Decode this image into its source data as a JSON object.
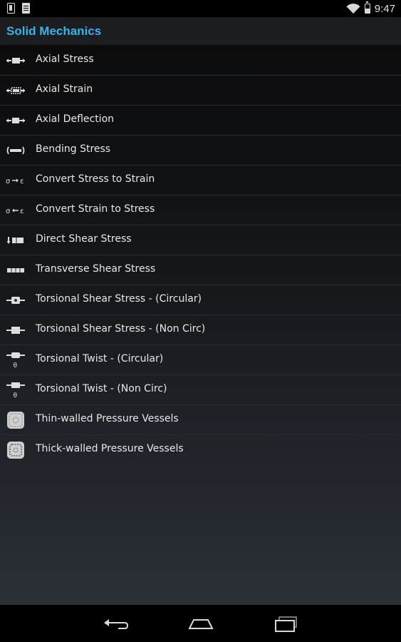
{
  "status_bar": {
    "time": "9:47",
    "icons": [
      "notification-icon",
      "sd-card-icon",
      "wifi-icon",
      "battery-icon"
    ]
  },
  "action_bar": {
    "title": "Solid Mechanics"
  },
  "list": {
    "items": [
      {
        "label": "Axial Stress",
        "icon": "axial-stress-icon"
      },
      {
        "label": "Axial Strain",
        "icon": "axial-strain-icon"
      },
      {
        "label": "Axial Deflection",
        "icon": "axial-deflection-icon"
      },
      {
        "label": "Bending Stress",
        "icon": "bending-stress-icon"
      },
      {
        "label": "Convert Stress to Strain",
        "icon": "sigma-to-epsilon-icon"
      },
      {
        "label": "Convert Strain to Stress",
        "icon": "sigma-from-epsilon-icon"
      },
      {
        "label": "Direct Shear Stress",
        "icon": "direct-shear-icon"
      },
      {
        "label": "Transverse Shear Stress",
        "icon": "transverse-shear-icon"
      },
      {
        "label": "Torsional Shear Stress - (Circular)",
        "icon": "torsion-circular-icon"
      },
      {
        "label": "Torsional Shear Stress - (Non Circ)",
        "icon": "torsion-noncirc-icon"
      },
      {
        "label": "Torsional Twist - (Circular)",
        "icon": "twist-circular-icon"
      },
      {
        "label": "Torsional Twist - (Non Circ)",
        "icon": "twist-noncirc-icon"
      },
      {
        "label": "Thin-walled Pressure Vessels",
        "icon": "thin-vessel-icon"
      },
      {
        "label": "Thick-walled Pressure Vessels",
        "icon": "thick-vessel-icon"
      }
    ]
  },
  "nav_bar": {
    "buttons": [
      "back-icon",
      "home-icon",
      "recent-apps-icon"
    ]
  },
  "colors": {
    "accent": "#38b4e6",
    "action_bar_bg": "#1c1d20",
    "text": "#e8e8e8"
  }
}
